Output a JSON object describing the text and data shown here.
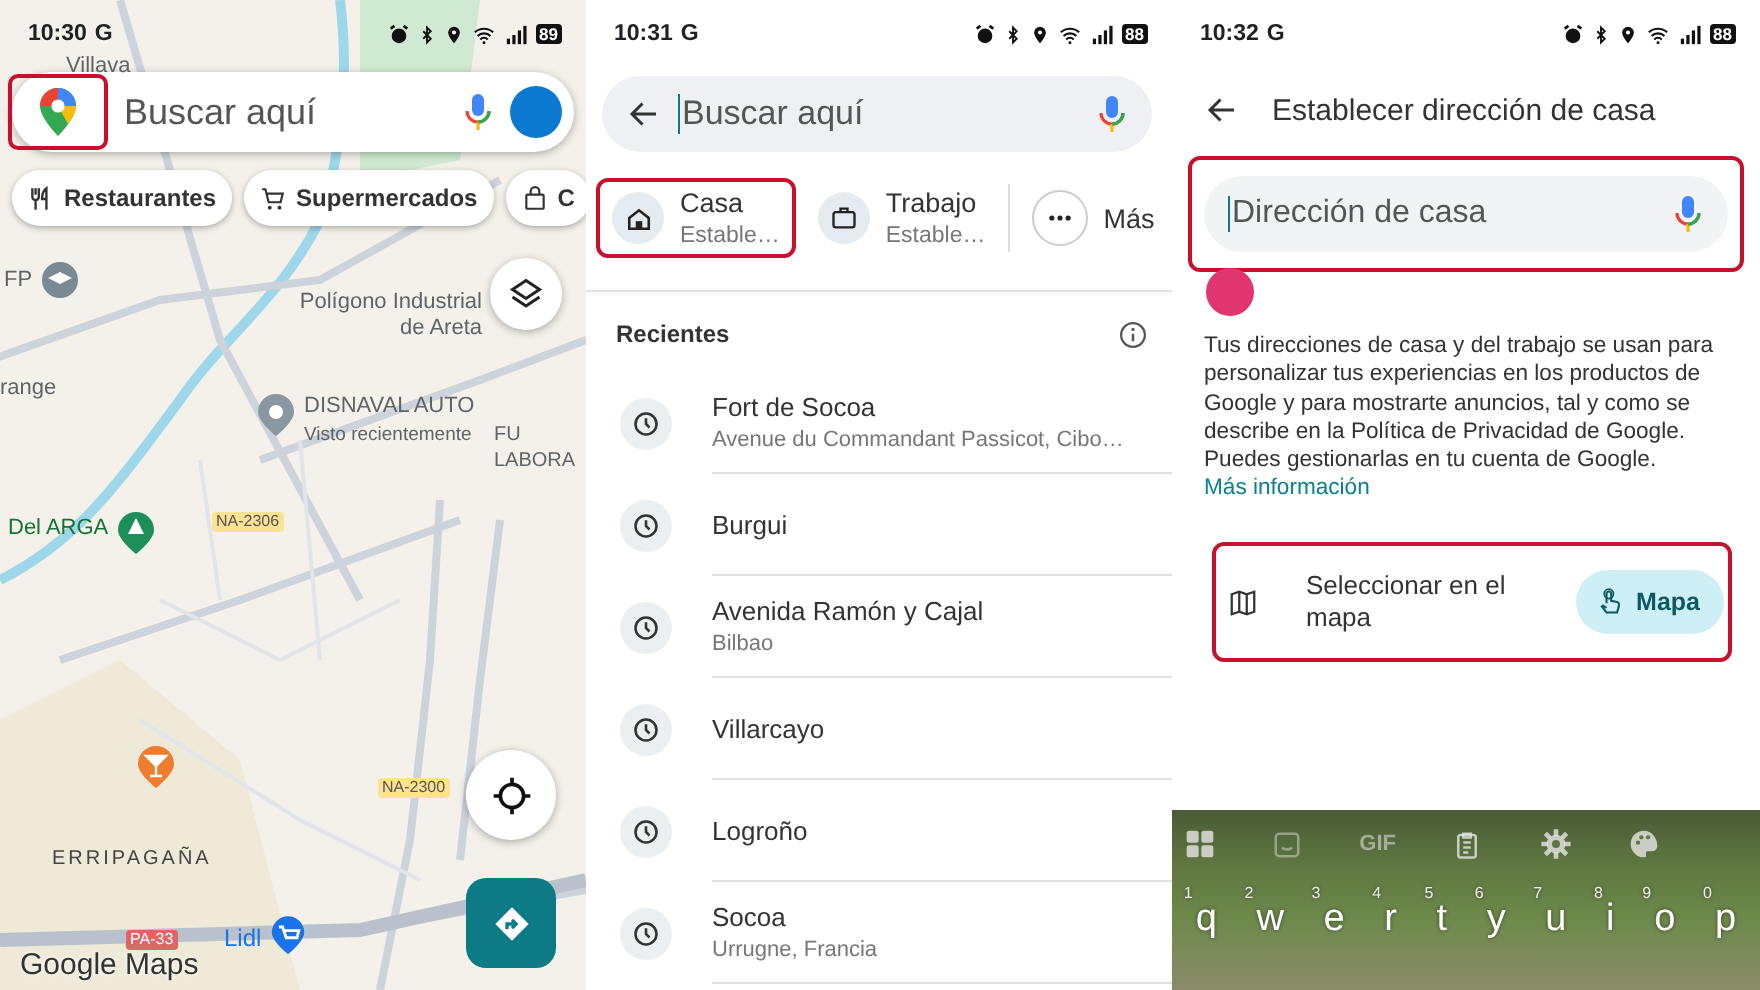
{
  "map_screen": {
    "status_bar": {
      "time": "10:30",
      "carrier": "G",
      "battery": "89"
    },
    "search": {
      "placeholder": "Buscar aquí",
      "logo_highlighted": true
    },
    "chips": [
      {
        "label": "Restaurantes"
      },
      {
        "label": "Supermercados"
      },
      {
        "label": "C"
      }
    ],
    "map_labels": [
      {
        "text": "Villava",
        "kind": "place"
      },
      {
        "text": "FP",
        "kind": "place"
      },
      {
        "text": "Polígono Industrial de Areta",
        "kind": "place"
      },
      {
        "text": "DISNAVAL AUTO",
        "kind": "place"
      },
      {
        "text": "Visto recientemente",
        "kind": "note"
      },
      {
        "text": "range",
        "kind": "place"
      },
      {
        "text": "FU LABORA",
        "kind": "place"
      },
      {
        "text": "Del ARGA",
        "kind": "park"
      },
      {
        "text": "NA-2306",
        "kind": "road"
      },
      {
        "text": "NA-2300",
        "kind": "road"
      },
      {
        "text": "ERRIPAGAÑA",
        "kind": "district"
      },
      {
        "text": "PA-33",
        "kind": "highway"
      },
      {
        "text": "Lidl",
        "kind": "shop"
      }
    ],
    "logo": "Google Maps"
  },
  "search_screen": {
    "status_bar": {
      "time": "10:31",
      "carrier": "G",
      "battery": "88"
    },
    "search": {
      "placeholder": "Buscar aquí"
    },
    "shortcuts": [
      {
        "kind": "home",
        "title": "Casa",
        "subtitle": "Estable…",
        "highlighted": true
      },
      {
        "kind": "work",
        "title": "Trabajo",
        "subtitle": "Estable…",
        "highlighted": false
      },
      {
        "kind": "more",
        "title": "Más",
        "highlighted": false
      }
    ],
    "recents_title": "Recientes",
    "recents": [
      {
        "title": "Fort de Socoa",
        "subtitle": "Avenue du Commandant Passicot, Cibo…"
      },
      {
        "title": "Burgui"
      },
      {
        "title": "Avenida Ramón y Cajal",
        "subtitle": "Bilbao"
      },
      {
        "title": "Villarcayo"
      },
      {
        "title": "Logroño"
      },
      {
        "title": "Socoa",
        "subtitle": "Urrugne, Francia"
      }
    ]
  },
  "home_screen": {
    "status_bar": {
      "time": "10:32",
      "carrier": "G",
      "battery": "88"
    },
    "title": "Establecer dirección de casa",
    "address_field": {
      "placeholder": "Dirección de casa",
      "highlighted": true
    },
    "notice": "Tus direcciones de casa y del trabajo se usan para personalizar tus experiencias en los productos de Google y para mostrarte anuncios, tal y como se describe en la Política de Privacidad de Google. Puedes gestionarlas en tu cuenta de Google.",
    "notice_link": "Más información",
    "map_option": {
      "label": "Seleccionar en el mapa",
      "button": "Mapa",
      "highlighted": true
    },
    "keyboard": {
      "toolbar_text": "GIF",
      "keys": [
        {
          "key": "q",
          "hint": "1"
        },
        {
          "key": "w",
          "hint": "2"
        },
        {
          "key": "e",
          "hint": "3"
        },
        {
          "key": "r",
          "hint": "4"
        },
        {
          "key": "t",
          "hint": "5"
        },
        {
          "key": "y",
          "hint": "6"
        },
        {
          "key": "u",
          "hint": "7"
        },
        {
          "key": "i",
          "hint": "8"
        },
        {
          "key": "o",
          "hint": "9"
        },
        {
          "key": "p",
          "hint": "0"
        }
      ]
    }
  }
}
